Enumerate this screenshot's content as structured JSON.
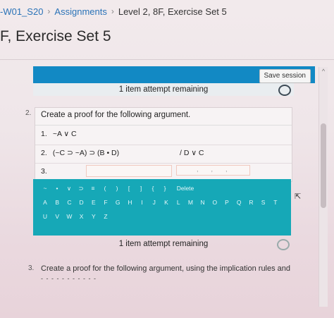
{
  "breadcrumb": {
    "course": "-W01_S20",
    "sep1": "›",
    "assignments": "Assignments",
    "sep2": "›",
    "current": "Level 2, 8F, Exercise Set 5"
  },
  "page_title": "F, Exercise Set 5",
  "session": {
    "save_label": "Save session",
    "attempts_top": "1 item attempt remaining",
    "attempts_bottom": "1 item attempt remaining"
  },
  "question2": {
    "number": "2.",
    "prompt": "Create a proof for the following argument.",
    "lines": [
      {
        "num": "1.",
        "formula": "~A ∨ C"
      },
      {
        "num": "2.",
        "formula": "(~C ⊃ ~A) ⊃ (B • D)",
        "justification": "/ D ∨ C"
      },
      {
        "num": "3.",
        "formula": ""
      }
    ],
    "line3_just_marks": ",,,"
  },
  "keyboard": {
    "symbols": [
      "~",
      "•",
      "∨",
      "⊃",
      "≡",
      "(",
      ")",
      "[",
      "]",
      "{",
      "}"
    ],
    "delete_label": "Delete",
    "letters_row1": [
      "A",
      "B",
      "C",
      "D",
      "E",
      "F",
      "G",
      "H",
      "I",
      "J",
      "K",
      "L",
      "M",
      "N",
      "O",
      "P",
      "Q",
      "R",
      "S",
      "T"
    ],
    "letters_row2": [
      "U",
      "V",
      "W",
      "X",
      "Y",
      "Z"
    ]
  },
  "question3": {
    "number": "3.",
    "prompt": "Create a proof for the following argument, using the implication rules and",
    "cut_text": "- - - - - - - - - - -"
  },
  "scrollbar": {
    "up_arrow": "^"
  },
  "cursor": "⇱",
  "colors": {
    "session_bar": "#1289c4",
    "keyboard": "#16a8b7",
    "link": "#2a73b8"
  }
}
